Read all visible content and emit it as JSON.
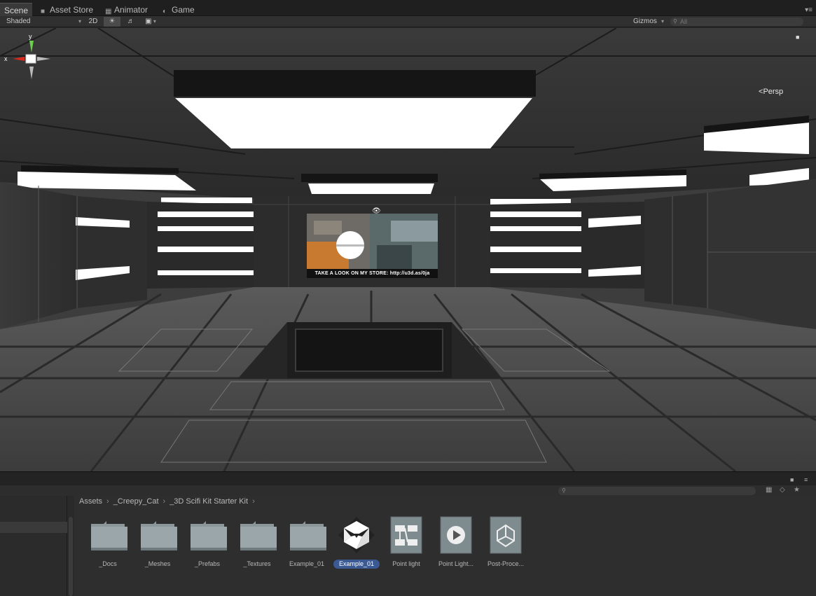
{
  "tabs": [
    {
      "label": "Scene",
      "icon": "scene-icon"
    },
    {
      "label": "Asset Store",
      "icon": "lock-icon"
    },
    {
      "label": "Animator",
      "icon": "animator-icon"
    },
    {
      "label": "Game",
      "icon": "game-icon"
    }
  ],
  "toolbar": {
    "shading_mode": "Shaded",
    "mode_2d": "2D",
    "lighting_icon": "sun-icon",
    "audio_icon": "audio-icon",
    "effects_icon": "image-icon",
    "gizmos_label": "Gizmos",
    "search_placeholder": "All"
  },
  "viewport": {
    "projection_label": "Persp",
    "axis_x": "x",
    "axis_y": "y",
    "screen_caption": "TAKE A LOOK ON MY STORE: http://u3d.as/0ja"
  },
  "project": {
    "breadcrumb": [
      "Assets",
      "_Creepy_Cat",
      "_3D Scifi Kit Starter Kit"
    ],
    "assets": [
      {
        "name": "_Docs",
        "type": "folder"
      },
      {
        "name": "_Meshes",
        "type": "folder"
      },
      {
        "name": "_Prefabs",
        "type": "folder"
      },
      {
        "name": "_Textures",
        "type": "folder"
      },
      {
        "name": "Example_01",
        "type": "folder"
      },
      {
        "name": "Example_01",
        "type": "unity-scene",
        "selected": true
      },
      {
        "name": "Point light",
        "type": "animator-controller"
      },
      {
        "name": "Point Light...",
        "type": "animation-clip"
      },
      {
        "name": "Post-Proce...",
        "type": "unity-asset"
      }
    ]
  }
}
